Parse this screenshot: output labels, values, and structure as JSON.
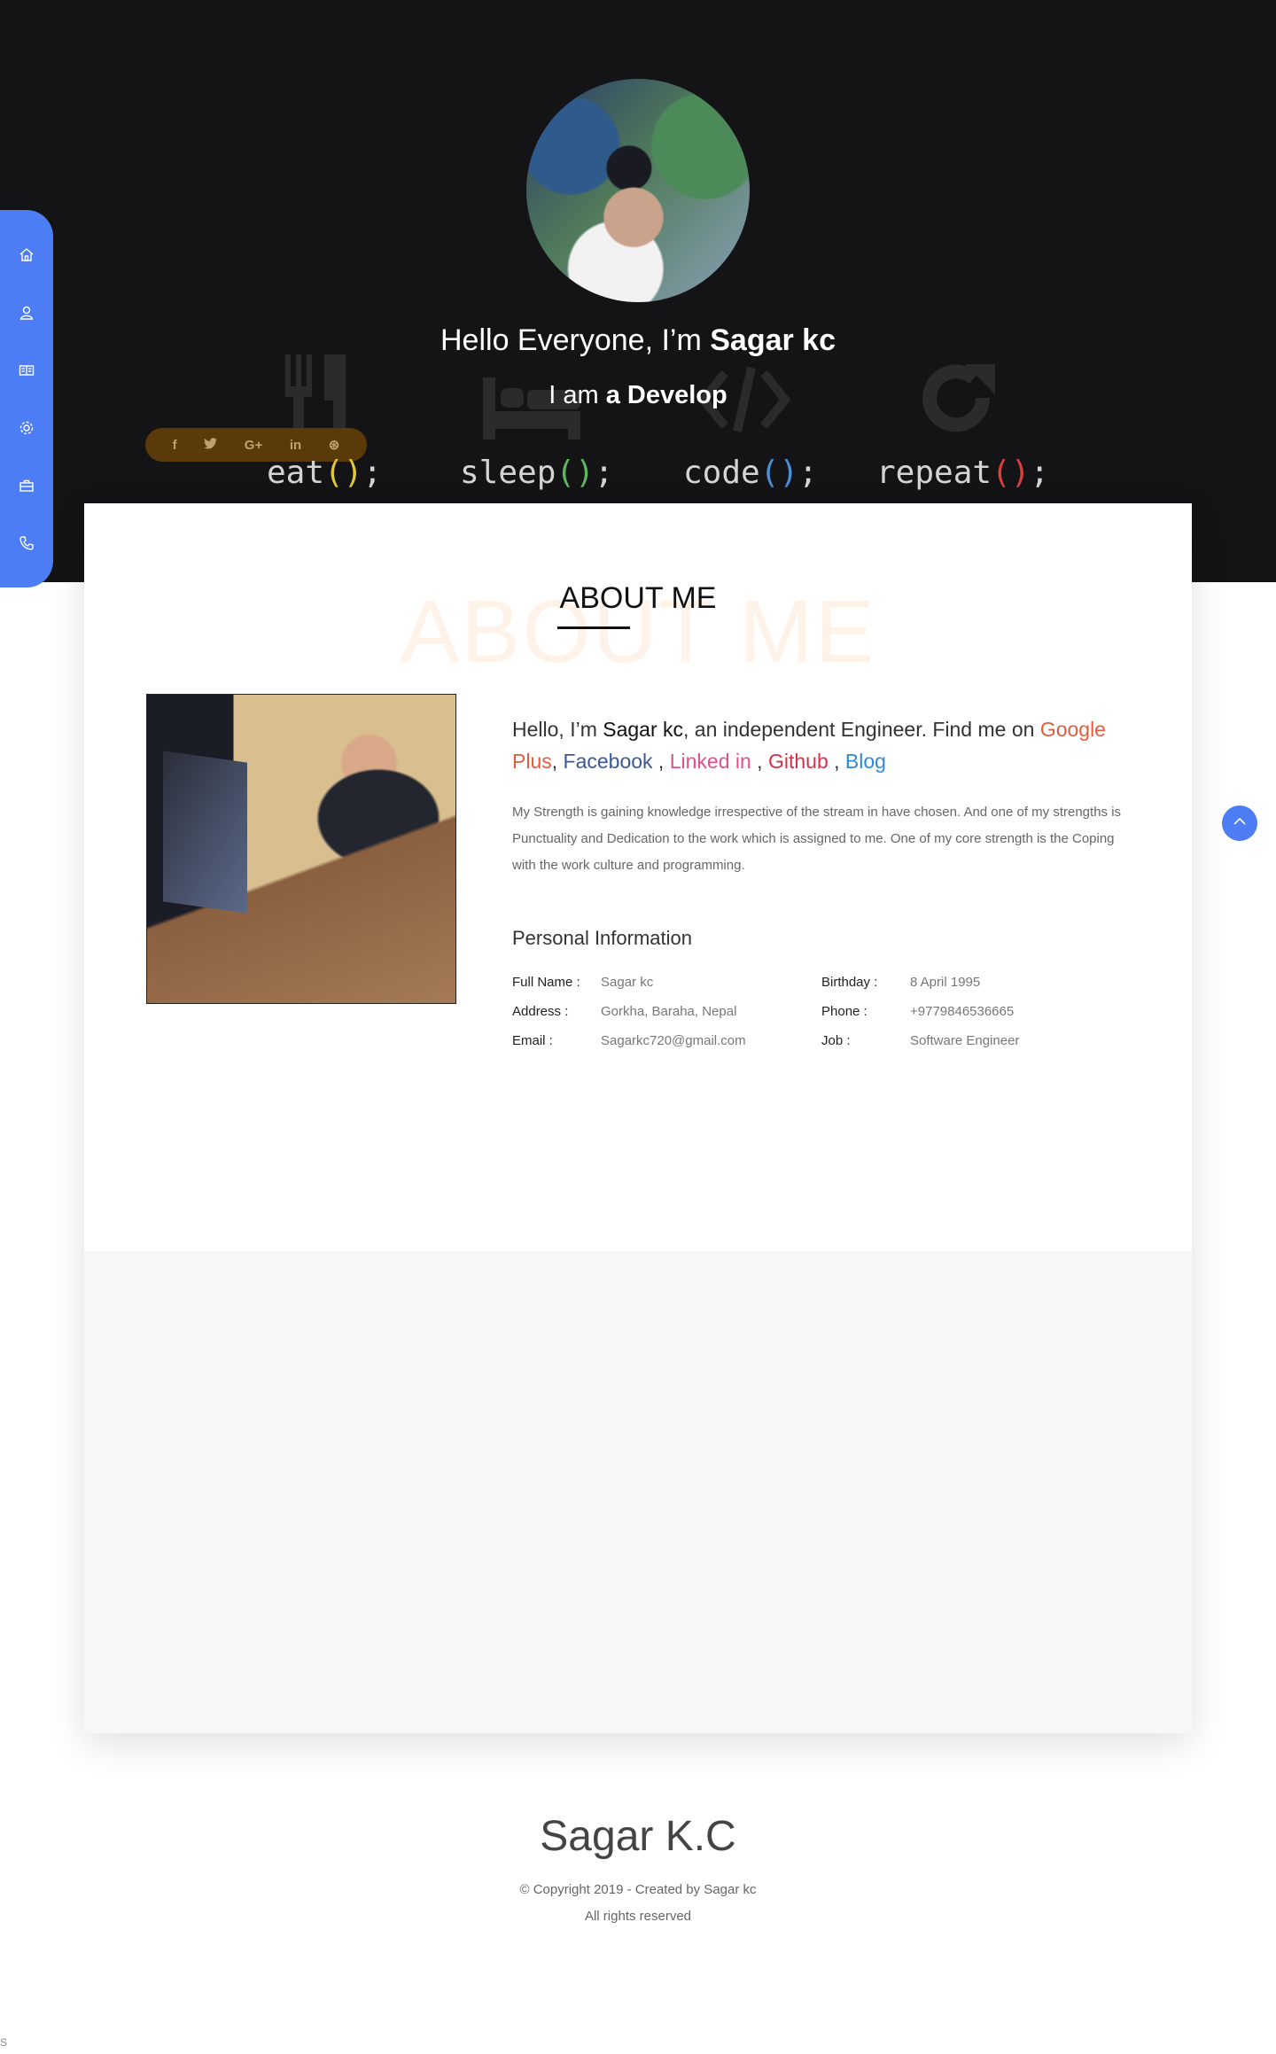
{
  "hero": {
    "greeting_prefix": "Hello Everyone, I’m ",
    "greeting_name": "Sagar kc",
    "role_prefix": "I am ",
    "role_value": "a Develop",
    "code_words": [
      {
        "word": "eat",
        "color": "#e0c83a"
      },
      {
        "word": "sleep",
        "color": "#5fb85f"
      },
      {
        "word": "code",
        "color": "#4a8fd8"
      },
      {
        "word": "repeat",
        "color": "#d84040"
      }
    ],
    "code_suffix_open": "(",
    "code_suffix_close": ")",
    "code_semicolon": ";",
    "background_glyphs": [
      "fork-knife-icon",
      "bed-icon",
      "code-icon",
      "redo-icon"
    ]
  },
  "social": {
    "items": [
      {
        "name": "facebook-icon",
        "glyph": "f"
      },
      {
        "name": "twitter-icon",
        "glyph": "🐦"
      },
      {
        "name": "google-plus-icon",
        "glyph": "G+"
      },
      {
        "name": "linkedin-icon",
        "glyph": "in"
      },
      {
        "name": "dribbble-icon",
        "glyph": "⊛"
      }
    ]
  },
  "sidebar": {
    "items": [
      {
        "name": "home-icon"
      },
      {
        "name": "user-icon"
      },
      {
        "name": "resume-icon"
      },
      {
        "name": "settings-icon"
      },
      {
        "name": "briefcase-icon"
      },
      {
        "name": "phone-icon"
      }
    ]
  },
  "about": {
    "bg_title": "ABOUT ME",
    "title": "ABOUT ME",
    "intro_prefix": "Hello, I’m ",
    "intro_name": "Sagar kc",
    "intro_mid": ", an independent Engineer. Find me on ",
    "links": {
      "google_plus": "Google Plus",
      "facebook": "Facebook",
      "linkedin": "Linked in",
      "github": "Github",
      "blog": "Blog"
    },
    "sep_comma": ",",
    "sep_comma_space": " , ",
    "description": "My Strength is gaining knowledge irrespective of the stream in have chosen. And one of my strengths is Punctuality and Dedication to the work which is assigned to me. One of my core strength is the Coping with the work culture and programming.",
    "personal_title": "Personal Information",
    "info": {
      "full_name_label": "Full Name :",
      "full_name": "Sagar kc",
      "address_label": "Address :",
      "address": "Gorkha, Baraha, Nepal",
      "email_label": "Email :",
      "email": "Sagarkc720@gmail.com",
      "birthday_label": "Birthday :",
      "birthday": "8 April 1995",
      "phone_label": "Phone :",
      "phone": "+9779846536665",
      "job_label": "Job :",
      "job": "Software Engineer"
    }
  },
  "footer": {
    "name": "Sagar K.C",
    "copyright": "© Copyright 2019 - Created by Sagar kc",
    "rights": "All rights reserved",
    "corner": "S"
  },
  "colors": {
    "accent": "#4d7df5",
    "hero_bg": "#141416",
    "google": "#e45b3c",
    "facebook": "#3b5998",
    "linkedin": "#e0508a",
    "github": "#d8304a",
    "blog": "#2e8ad8"
  }
}
